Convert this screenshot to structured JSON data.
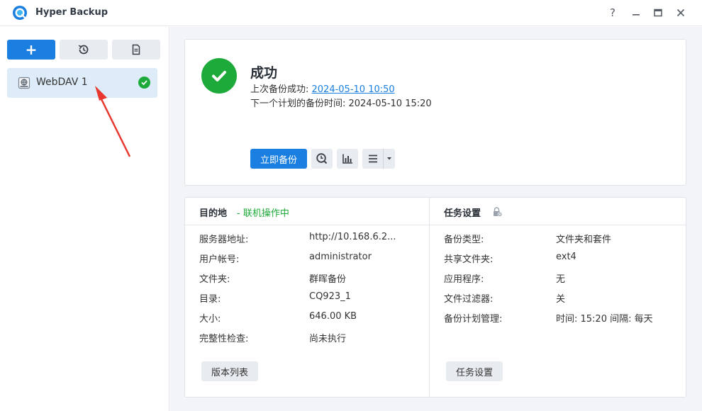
{
  "app": {
    "title": "Hyper Backup",
    "window_controls": {
      "help": "?",
      "minimize": "—",
      "maximize": "▭",
      "close": "✕"
    }
  },
  "sidebar": {
    "toolbar": {
      "add": "+"
    },
    "tasks": [
      {
        "name": "WebDAV 1",
        "status": "ok"
      }
    ]
  },
  "status": {
    "title": "成功",
    "last_backup_label": "上次备份成功: ",
    "last_backup_time": "2024-05-10 10:50",
    "next_backup_label": "下一个计划的备份时间: ",
    "next_backup_time": "2024-05-10 15:20",
    "backup_now": "立即备份"
  },
  "destination": {
    "title": "目的地",
    "state": "- 联机操作中",
    "rows": [
      {
        "key": "服务器地址:",
        "value": "http://10.168.6.2..."
      },
      {
        "key": "用户帐号:",
        "value": "administrator"
      },
      {
        "key": "文件夹:",
        "value": "群晖备份"
      },
      {
        "key": "目录:",
        "value": "CQ923_1"
      },
      {
        "key": "大小:",
        "value": "646.00 KB"
      },
      {
        "key": "完整性检查:",
        "value": "尚未执行"
      }
    ],
    "button": "版本列表"
  },
  "task_settings": {
    "title": "任务设置",
    "rows": [
      {
        "key": "备份类型:",
        "value": "文件夹和套件"
      },
      {
        "key": "共享文件夹:",
        "value": "ext4"
      },
      {
        "key": "应用程序:",
        "value": "无"
      },
      {
        "key": "文件过滤器:",
        "value": "关"
      },
      {
        "key": "备份计划管理:",
        "value": "时间: 15:20 间隔: 每天"
      }
    ],
    "button": "任务设置"
  },
  "colors": {
    "accent": "#1a7fe0",
    "success": "#1eaa3a",
    "annotation": "#e8372e"
  }
}
